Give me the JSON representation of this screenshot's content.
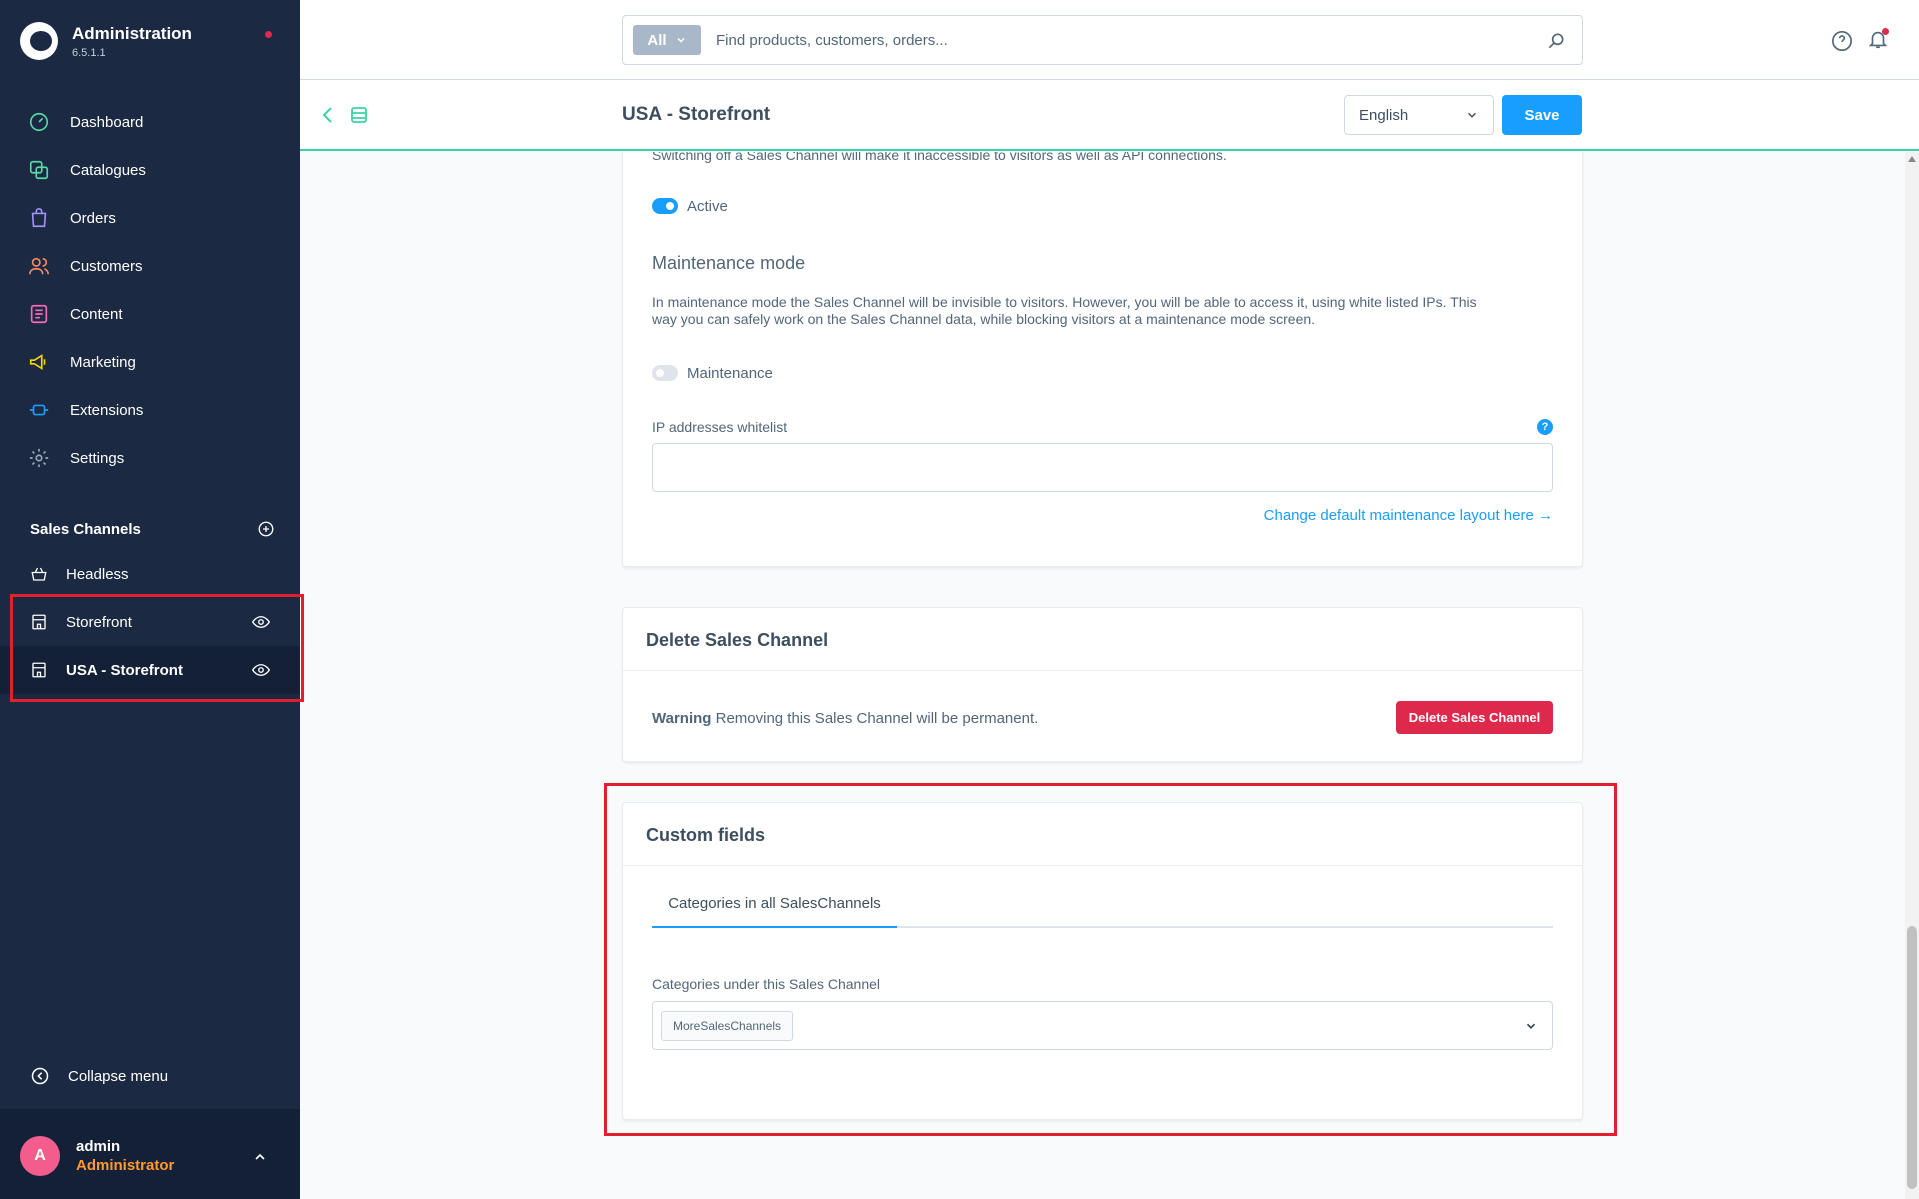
{
  "app": {
    "title": "Administration",
    "version": "6.5.1.1"
  },
  "nav": {
    "items": [
      {
        "label": "Dashboard",
        "icon": "dashboard-icon",
        "color": "#57d9a3"
      },
      {
        "label": "Catalogues",
        "icon": "catalogue-icon",
        "color": "#57d9a3"
      },
      {
        "label": "Orders",
        "icon": "orders-icon",
        "color": "#a092f0"
      },
      {
        "label": "Customers",
        "icon": "customers-icon",
        "color": "#f88962"
      },
      {
        "label": "Content",
        "icon": "content-icon",
        "color": "#ff68b4"
      },
      {
        "label": "Marketing",
        "icon": "marketing-icon",
        "color": "#ffd700"
      },
      {
        "label": "Extensions",
        "icon": "extensions-icon",
        "color": "#189eff"
      },
      {
        "label": "Settings",
        "icon": "settings-icon",
        "color": "#9aa8b5"
      }
    ]
  },
  "sales_channels": {
    "heading": "Sales Channels",
    "items": [
      {
        "label": "Headless",
        "icon": "basket-icon"
      },
      {
        "label": "Storefront",
        "icon": "storefront-icon"
      },
      {
        "label": "USA - Storefront",
        "icon": "storefront-icon",
        "active": true
      }
    ]
  },
  "sidebar_footer": {
    "collapse_label": "Collapse menu",
    "user_initial": "A",
    "user_name": "admin",
    "user_role": "Administrator"
  },
  "search": {
    "type_label": "All",
    "placeholder": "Find products, customers, orders..."
  },
  "smartbar": {
    "title": "USA - Storefront",
    "language": "English",
    "save_label": "Save"
  },
  "status_card": {
    "intro": "Switching off a Sales Channel will make it inaccessible to visitors as well as API connections.",
    "active_label": "Active",
    "maintenance_title": "Maintenance mode",
    "maintenance_text_line1": "In maintenance mode the Sales Channel will be invisible to visitors. However, you will be able to access it, using white listed IPs. This",
    "maintenance_text_line2": "way you can safely work on the Sales Channel data, while blocking visitors at a maintenance mode screen.",
    "maintenance_label": "Maintenance",
    "ip_label": "IP addresses whitelist",
    "ip_value": "",
    "help_glyph": "?",
    "layout_link": "Change default maintenance layout here →"
  },
  "delete_card": {
    "title": "Delete Sales Channel",
    "warning_bold": "Warning",
    "warning_text": " Removing this Sales Channel will be permanent.",
    "button_label": "Delete Sales Channel"
  },
  "custom_fields_card": {
    "title": "Custom fields",
    "tab_label": "Categories in all SalesChannels",
    "field_label": "Categories under this Sales Channel",
    "selected_chip": "MoreSalesChannels"
  },
  "colors": {
    "sidebar_bg": "#1b2942",
    "primary": "#189eff",
    "danger": "#de294c",
    "highlight": "#e0202f",
    "accent_line": "#37d5a3"
  }
}
